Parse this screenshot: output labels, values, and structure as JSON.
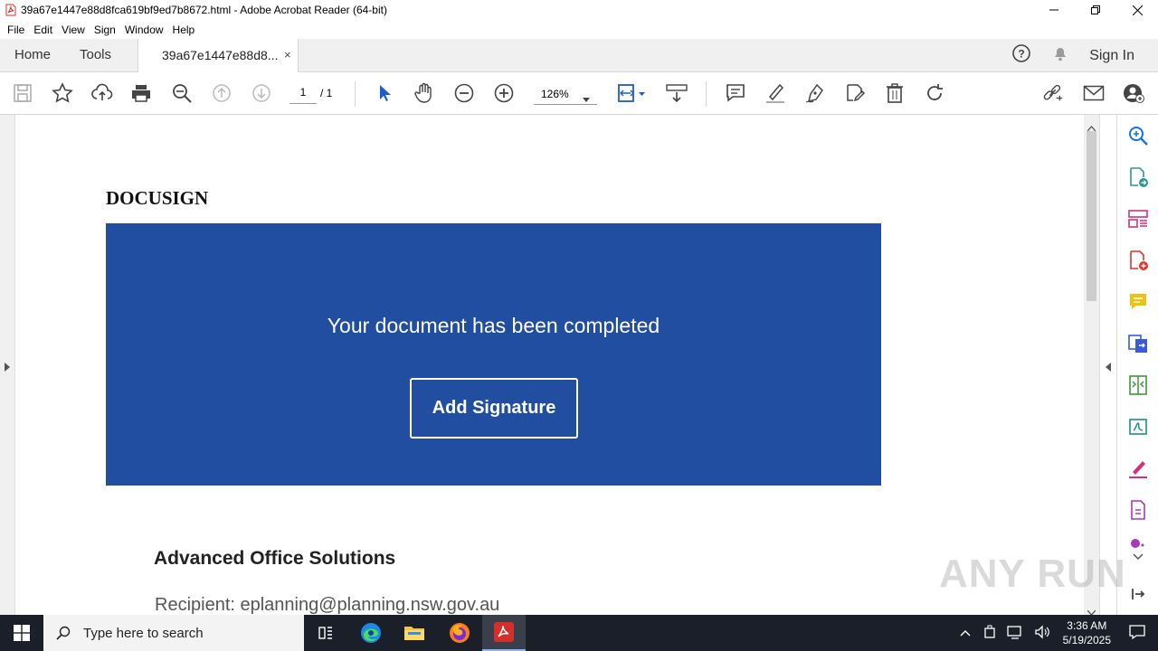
{
  "window": {
    "title": "39a67e1447e88d8fca619bf9ed7b8672.html - Adobe Acrobat Reader (64-bit)"
  },
  "menu": [
    "File",
    "Edit",
    "View",
    "Sign",
    "Window",
    "Help"
  ],
  "tabs": {
    "home": "Home",
    "tools": "Tools",
    "document": "39a67e1447e88d8...",
    "close": "×"
  },
  "header": {
    "signin": "Sign In"
  },
  "toolbar": {
    "page_current": "1",
    "page_total": "/ 1",
    "zoom": "126%"
  },
  "document": {
    "logo_text": "DOCUSIGN",
    "banner_message": "Your document has been completed",
    "cta_label": "Add Signature",
    "company": "Advanced Office Solutions",
    "recipient": "Recipient: eplanning@planning.nsw.gov.au",
    "banner_color": "#214ea1"
  },
  "watermark": "ANY RUN",
  "taskbar": {
    "search_placeholder": "Type here to search",
    "time": "3:36 AM",
    "date": "5/19/2025"
  }
}
